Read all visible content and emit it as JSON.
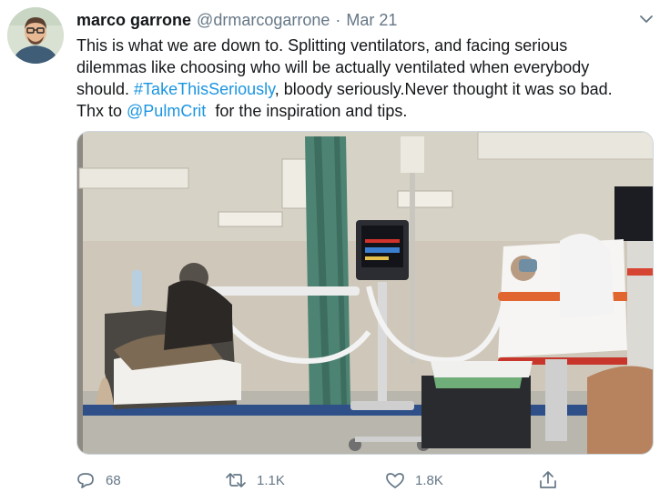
{
  "author": {
    "name": "marco garrone",
    "handle": "@drmarcogarrone",
    "separator": "·",
    "date": "Mar 21"
  },
  "tweet": {
    "line1": "This is what we are down to. Splitting ventilators, and facing serious",
    "line2": "dilemmas like choosing who will be actually ventilated when everybody",
    "line3_before": "should. ",
    "hashtag": "#TakeThisSeriously",
    "line3_after": ", bloody seriously.Never thought it was so bad.",
    "line4_before": "Thx to ",
    "mention": "@PulmCrit",
    "line4_after": "  for the inspiration and tips."
  },
  "stats": {
    "replies": "68",
    "retweets": "1.1K",
    "likes": "1.8K"
  },
  "icons": {
    "reply": "reply-icon",
    "retweet": "retweet-icon",
    "like": "heart-icon",
    "share": "share-icon",
    "menu": "chevron-down-icon"
  },
  "colors": {
    "link": "#1b95e0",
    "secondary_text": "#657786",
    "primary_text": "#14171a",
    "media_border": "#ccd6dd"
  }
}
